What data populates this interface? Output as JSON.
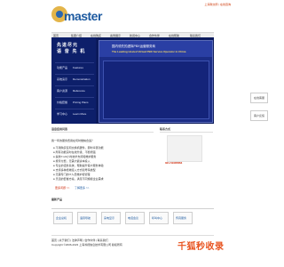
{
  "header": {
    "logo_text": "master",
    "top_links": "上海软交所 | 在线咨询"
  },
  "nav": {
    "items": [
      "首页",
      "集团介绍",
      "在线购买",
      "案例展示",
      "新闻中心",
      "合作伙伴",
      "在线帮助",
      "联系我们"
    ]
  },
  "hero": {
    "title_line1": "先进尽元",
    "title_line2": "语 音 先 机",
    "menu": [
      {
        "cn": "功能产品",
        "en": "Features"
      },
      {
        "cn": "系统演示",
        "en": "Demonstration"
      },
      {
        "cn": "客户资源",
        "en": "Reference"
      },
      {
        "cn": "价格套餐",
        "en": "Pricing Plans"
      },
      {
        "cn": "学习中心",
        "en": "Learn More"
      }
    ],
    "banner_cn": "国内领先的虚拟PBX运营服务商",
    "banner_en": "The Leading Hosted Virtual PBX Service Operator in China"
  },
  "side_buttons": [
    "在线客服",
    "客户反馈"
  ],
  "faq": {
    "title": "语音应用问答",
    "question": "我一年的服务费用在何时缴纳合适？",
    "bullets": [
      "不用购买任何交换机硬件，即时享受功能",
      "所有功能实时在线升级、不断增强",
      "提供7×24小时技术支持和维护服务",
      "按月付费，无需大额资本投入",
      "专业的话务系统，帮助提升客户服务体验",
      "支持多种终端接入方式和号码类型",
      "无需专门的IT人员维护和管理",
      "灵活的套餐方案，满足不同规模企业需求"
    ],
    "more_left": "更多问题 >>",
    "more_right": "了解更多 >>"
  },
  "contact": {
    "title": "联系方式",
    "phone": "021-51087864"
  },
  "cases": {
    "title": "最新产品",
    "items": [
      "企业总机",
      "语音导航",
      "来电显示",
      "电话会议",
      "呼叫中心",
      "传真服务"
    ]
  },
  "footer": {
    "nav": "首页 | 关于我们 | 法律声明 | 合作伙伴 | 联系我们",
    "copyright": "Copyright ©2006-2023 上海寻视信息技术有限公司 版权所有"
  },
  "watermark": "千狐秒收录"
}
